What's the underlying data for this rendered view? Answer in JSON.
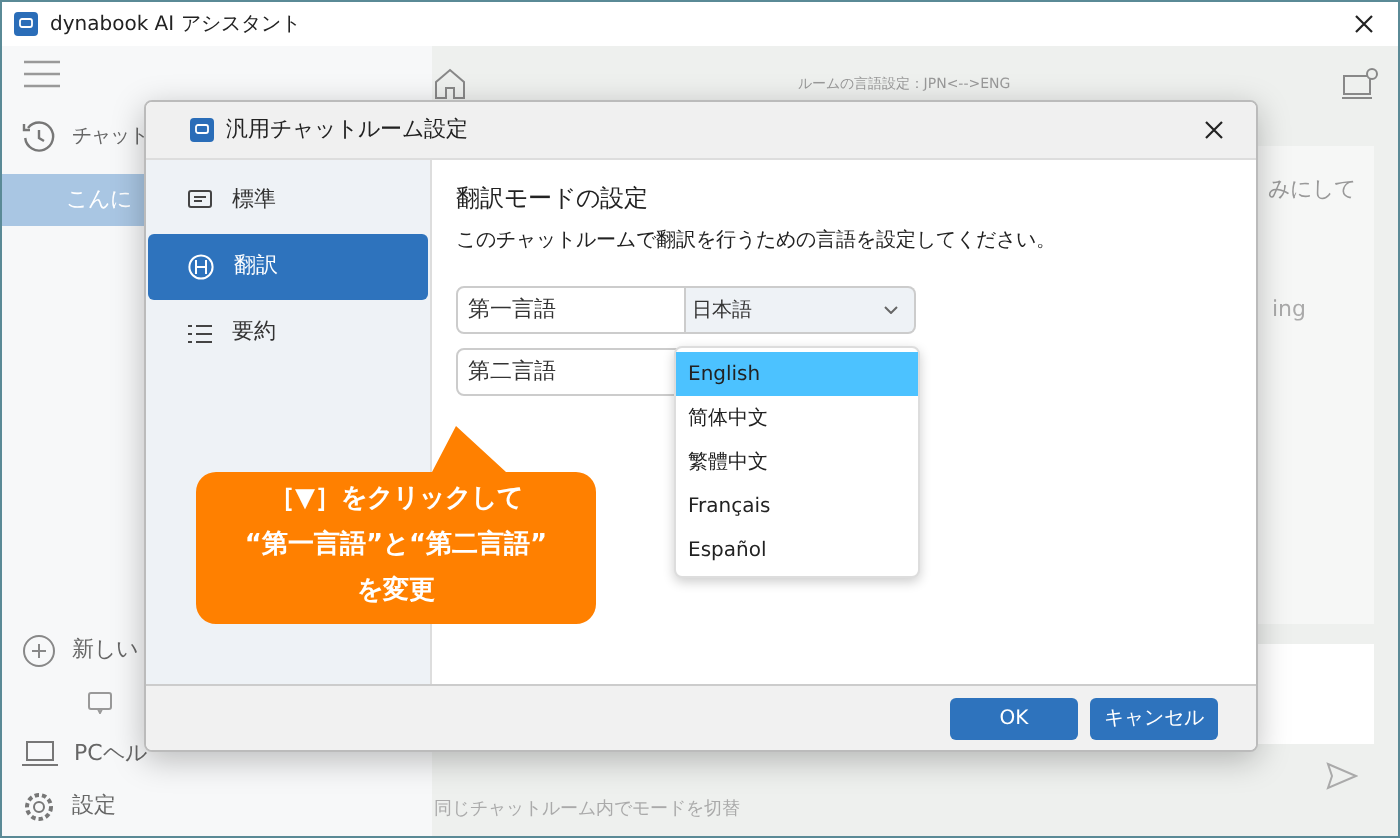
{
  "window": {
    "title": "dynabook AI アシスタント"
  },
  "sidebar": {
    "history_label": "チャット",
    "items": [
      {
        "label": "こんに",
        "selected": true
      }
    ],
    "new_chat": "新しい",
    "pc_help": "PCヘル",
    "settings": "設定"
  },
  "main": {
    "room_language": "ルームの言語設定：JPN<-->ENG",
    "message_fragments": [
      "みにして",
      "ing"
    ],
    "footer_hint": "同じチャットルーム内でモードを切替"
  },
  "dialog": {
    "title": "汎用チャットルーム設定",
    "nav": [
      {
        "label": "標準",
        "kind": "chat",
        "selected": false
      },
      {
        "label": "翻訳",
        "kind": "translate",
        "selected": true
      },
      {
        "label": "要約",
        "kind": "list",
        "selected": false
      }
    ],
    "heading": "翻訳モードの設定",
    "description": "このチャットルームで翻訳を行うための言語を設定してください。",
    "fields": [
      {
        "label": "第一言語",
        "value": "日本語"
      },
      {
        "label": "第二言語"
      }
    ],
    "dropdown": [
      {
        "label": "English",
        "selected": true
      },
      {
        "label": "简体中文",
        "selected": false
      },
      {
        "label": "繁體中文",
        "selected": false
      },
      {
        "label": "Français",
        "selected": false
      },
      {
        "label": "Español",
        "selected": false
      }
    ],
    "buttons": [
      "OK",
      "キャンセル"
    ]
  },
  "callout": {
    "lines": [
      "［▼］をクリックして",
      "“第一言語”と“第二言語”",
      "を変更"
    ]
  }
}
